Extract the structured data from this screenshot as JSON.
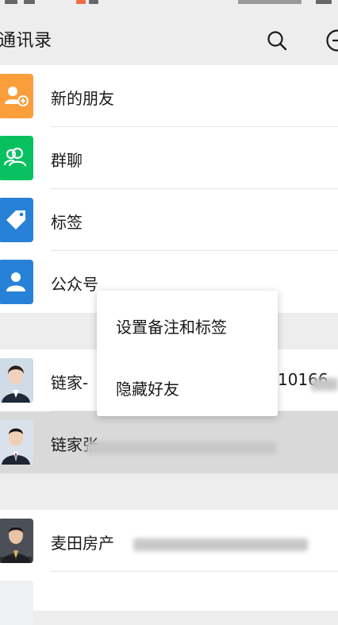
{
  "header": {
    "title": "通讯录"
  },
  "entries": [
    {
      "label": "新的朋友",
      "color": "#fa9d3b",
      "icon": "add-friend-icon"
    },
    {
      "label": "群聊",
      "color": "#07c160",
      "icon": "group-chat-icon"
    },
    {
      "label": "标签",
      "color": "#2782d7",
      "icon": "tag-icon"
    },
    {
      "label": "公众号",
      "color": "#2782d7",
      "icon": "official-account-icon"
    }
  ],
  "contacts": [
    {
      "name_visible": "链家-",
      "name_tail_visible": "10166"
    },
    {
      "name_visible": "链家张"
    },
    {
      "name_visible": "麦田房产"
    }
  ],
  "context_menu": {
    "items": [
      "设置备注和标签",
      "隐藏好友"
    ]
  }
}
